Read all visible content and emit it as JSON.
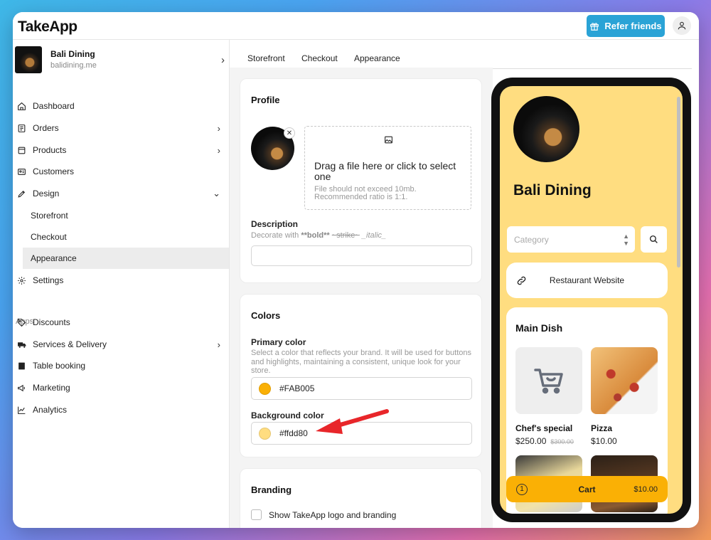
{
  "app": {
    "logo": "TakeApp",
    "refer_label": "Refer friends"
  },
  "store": {
    "name": "Bali Dining",
    "url": "balidining.me"
  },
  "sidebar": {
    "items": [
      {
        "label": "Dashboard",
        "icon": "home-icon"
      },
      {
        "label": "Orders",
        "icon": "orders-icon"
      },
      {
        "label": "Products",
        "icon": "products-icon"
      },
      {
        "label": "Customers",
        "icon": "customers-icon"
      },
      {
        "label": "Design",
        "icon": "design-icon"
      }
    ],
    "design_sub": [
      "Storefront",
      "Checkout",
      "Appearance"
    ],
    "settings": "Settings",
    "apps_label": "Apps",
    "apps": [
      {
        "label": "Discounts",
        "icon": "tag-icon"
      },
      {
        "label": "Services & Delivery",
        "icon": "truck-icon"
      },
      {
        "label": "Table booking",
        "icon": "book-icon"
      },
      {
        "label": "Marketing",
        "icon": "megaphone-icon"
      },
      {
        "label": "Analytics",
        "icon": "chart-icon"
      }
    ]
  },
  "tabs": [
    "Storefront",
    "Checkout",
    "Appearance"
  ],
  "profile": {
    "title": "Profile",
    "dropzone_main": "Drag a file here or click to select one",
    "dropzone_sub": "File should not exceed 10mb. Recommended ratio is 1:1.",
    "description_label": "Description",
    "description_help_prefix": "Decorate with ",
    "description_help_bold": "**bold**",
    "description_help_strike": "~strike~",
    "description_help_italic": "_italic_",
    "description_value": ""
  },
  "colors": {
    "title": "Colors",
    "primary_label": "Primary color",
    "primary_help": "Select a color that reflects your brand. It will be used for buttons and highlights, maintaining a consistent, unique look for your store.",
    "primary_value": "#FAB005",
    "background_label": "Background color",
    "background_value": "#ffdd80"
  },
  "branding": {
    "title": "Branding",
    "checkbox_label": "Show TakeApp logo and branding"
  },
  "preview": {
    "title": "Bali Dining",
    "category_placeholder": "Category",
    "link_label": "Restaurant Website",
    "section": "Main Dish",
    "products": [
      {
        "name": "Chef's special",
        "price": "$250.00",
        "old_price": "$300.00"
      },
      {
        "name": "Pizza",
        "price": "$10.00",
        "old_price": ""
      }
    ],
    "cart_count": "1",
    "cart_label": "Cart",
    "cart_total": "$10.00"
  }
}
